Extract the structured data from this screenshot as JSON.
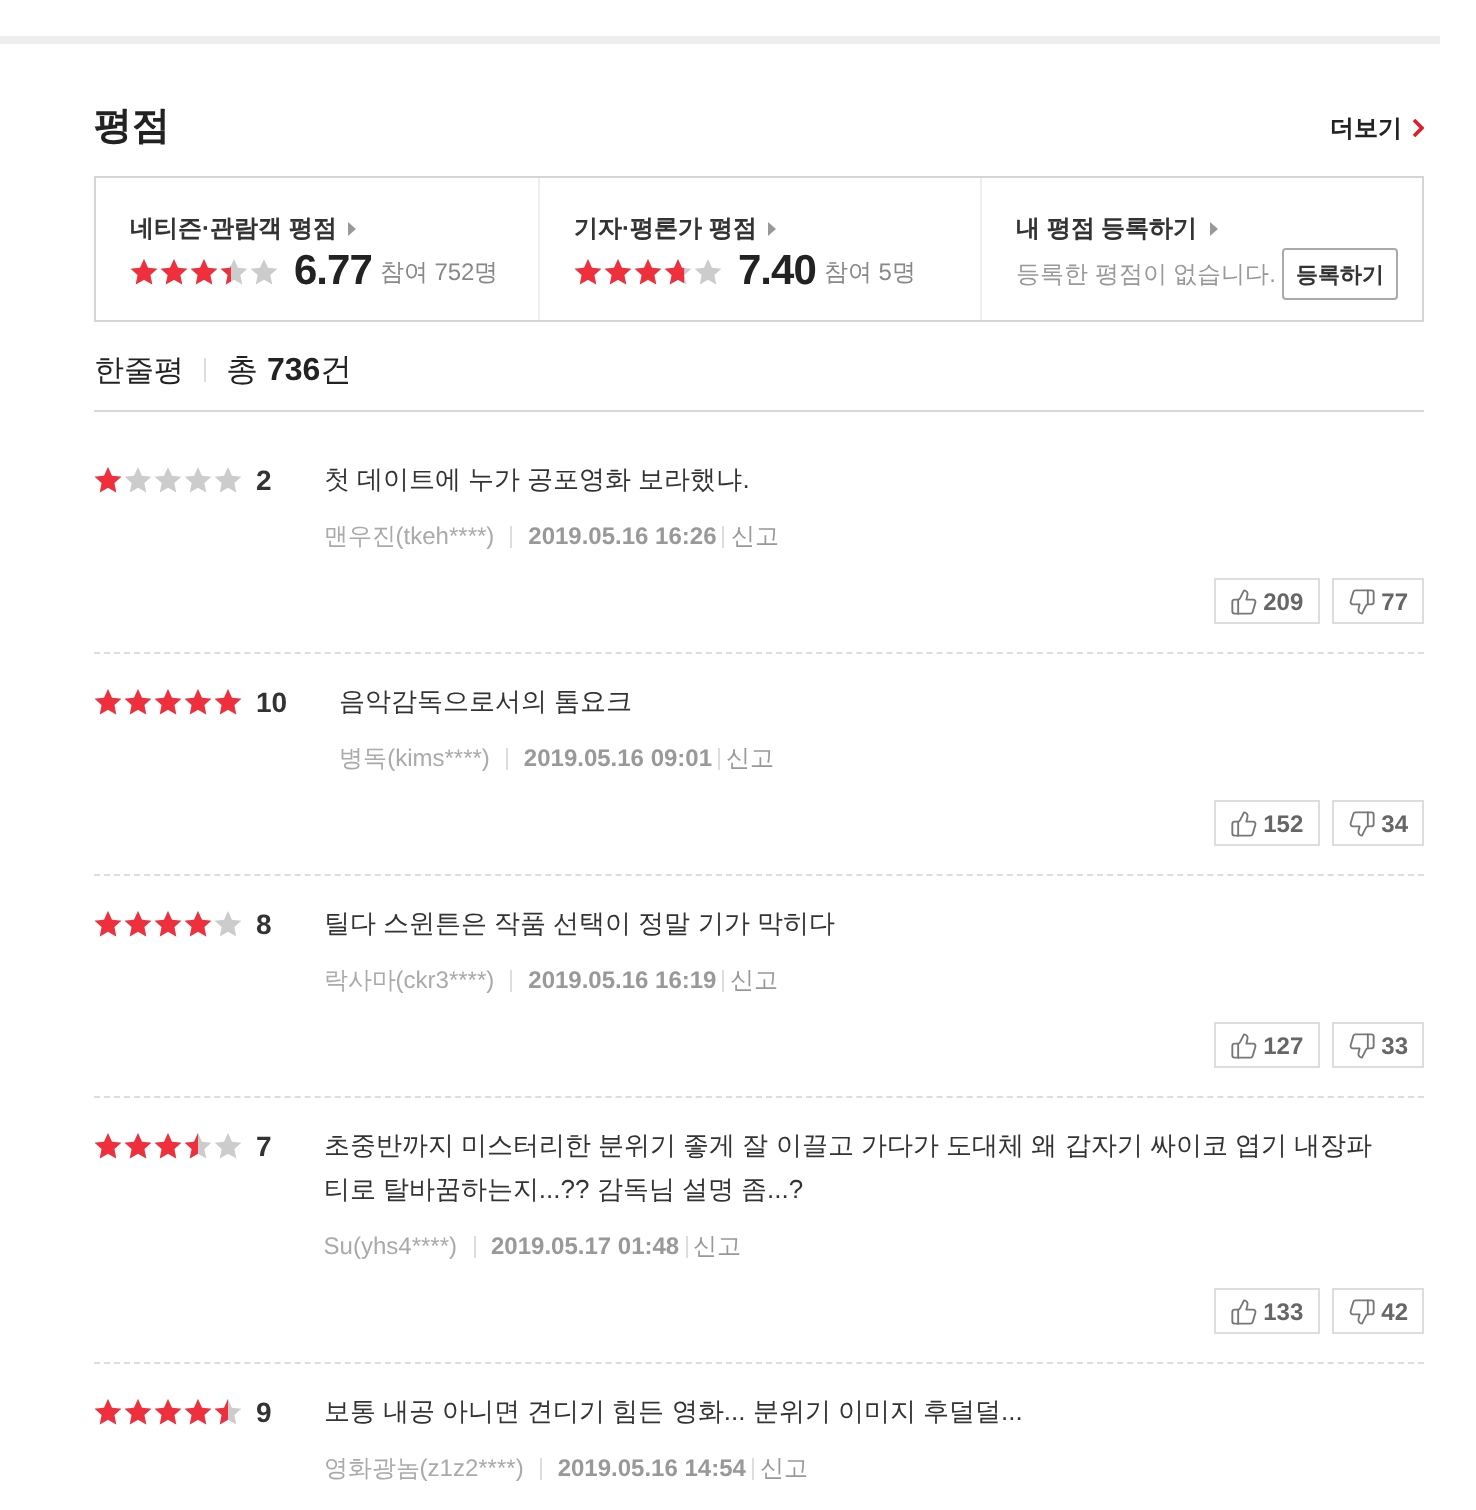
{
  "section": {
    "title": "평점",
    "more_link": "더보기"
  },
  "ratings": [
    {
      "kind": "score",
      "label": "네티즌·관람객 평점",
      "stars": 3.4,
      "score": "6.77",
      "participants": "참여 752명"
    },
    {
      "kind": "score",
      "label": "기자·평론가 평점",
      "stars": 3.7,
      "score": "7.40",
      "participants": "참여 5명"
    },
    {
      "kind": "register",
      "label": "내 평점 등록하기",
      "message": "등록한 평점이 없습니다.",
      "button": "등록하기"
    }
  ],
  "reviews_header": {
    "title": "한줄평",
    "total": "총 **736**건"
  },
  "reviews": [
    {
      "stars": 1,
      "score": "2",
      "text": "첫 데이트에 누가 공포영화 보라했냐.",
      "author": "맨우진(tkeh****)",
      "date": "2019.05.16 16:26",
      "report": "신고",
      "likes": "209",
      "dislikes": "77"
    },
    {
      "stars": 5,
      "score": "10",
      "text": "음악감독으로서의 톰요크",
      "author": "병독(kims****)",
      "date": "2019.05.16 09:01",
      "report": "신고",
      "likes": "152",
      "dislikes": "34"
    },
    {
      "stars": 4,
      "score": "8",
      "text": "틸다 스윈튼은 작품 선택이 정말 기가 막히다",
      "author": "락사마(ckr3****)",
      "date": "2019.05.16 16:19",
      "report": "신고",
      "likes": "127",
      "dislikes": "33"
    },
    {
      "stars": 3.5,
      "score": "7",
      "text": "초중반까지 미스터리한 분위기 좋게 잘 이끌고 가다가 도대체 왜 갑자기 싸이코 엽기 내장파티로 탈바꿈하는지...?? 감독님 설명 좀...?",
      "author": "Su(yhs4****)",
      "date": "2019.05.17 01:48",
      "report": "신고",
      "likes": "133",
      "dislikes": "42"
    },
    {
      "stars": 4.5,
      "score": "9",
      "text": "보통 내공 아니면 견디기 힘든 영화... 분위기 이미지 후덜덜...",
      "author": "영화광놈(z1z2****)",
      "date": "2019.05.16 14:54",
      "report": "신고"
    }
  ]
}
